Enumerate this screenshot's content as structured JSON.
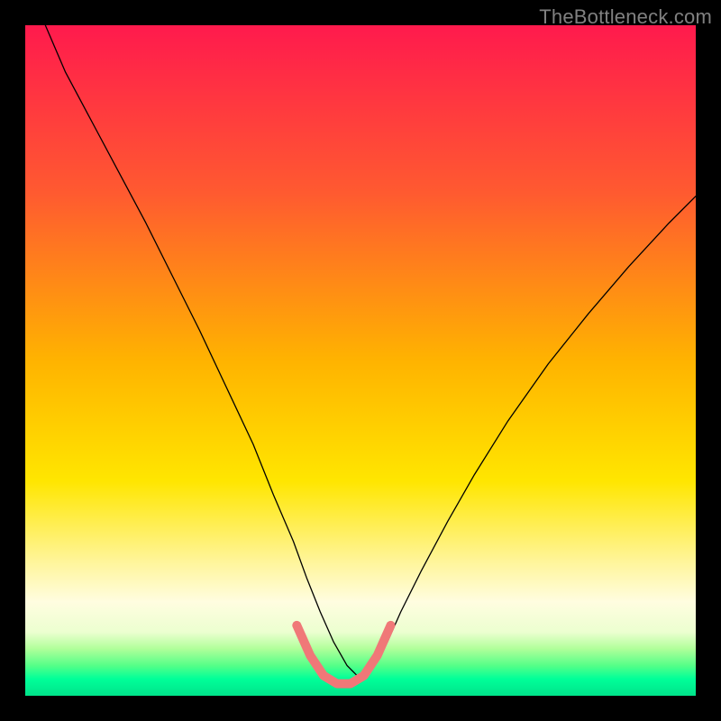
{
  "watermark": "TheBottleneck.com",
  "chart_data": {
    "type": "line",
    "title": "",
    "xlabel": "",
    "ylabel": "",
    "xlim": [
      0,
      100
    ],
    "ylim": [
      0,
      100
    ],
    "grid": false,
    "background": {
      "type": "linear-gradient",
      "direction": "top-to-bottom",
      "stops": [
        {
          "pos": 0.0,
          "color": "#ff1a4d"
        },
        {
          "pos": 0.25,
          "color": "#ff5a30"
        },
        {
          "pos": 0.5,
          "color": "#ffb300"
        },
        {
          "pos": 0.68,
          "color": "#ffe600"
        },
        {
          "pos": 0.8,
          "color": "#fff59a"
        },
        {
          "pos": 0.86,
          "color": "#fffde0"
        },
        {
          "pos": 0.905,
          "color": "#ecffd0"
        },
        {
          "pos": 0.93,
          "color": "#b0ff9a"
        },
        {
          "pos": 0.955,
          "color": "#55ff88"
        },
        {
          "pos": 0.975,
          "color": "#00ff99"
        },
        {
          "pos": 1.0,
          "color": "#00e38a"
        }
      ]
    },
    "series": [
      {
        "name": "bottleneck-curve",
        "stroke": "#000000",
        "stroke_width": 1.3,
        "x": [
          3,
          6,
          10,
          14,
          18,
          22,
          26,
          30,
          34,
          37,
          40,
          42,
          44,
          46,
          48,
          50,
          52,
          54,
          56,
          59,
          63,
          67,
          72,
          78,
          84,
          90,
          96,
          100
        ],
        "y": [
          100,
          93,
          85.5,
          78,
          70.5,
          62.5,
          54.5,
          46,
          37.5,
          30,
          23,
          17.5,
          12.5,
          8,
          4.5,
          2.5,
          4.5,
          8,
          12.5,
          18.5,
          26,
          33,
          41,
          49.5,
          57,
          64,
          70.5,
          74.5
        ]
      }
    ],
    "annotations": [
      {
        "name": "valley-highlight",
        "type": "path",
        "stroke": "#f07878",
        "stroke_width": 10,
        "x": [
          40.5,
          42.5,
          44.5,
          46.5,
          48.5,
          50.5,
          52.5,
          54.5
        ],
        "y": [
          10.5,
          6.0,
          3.0,
          1.8,
          1.8,
          3.0,
          6.0,
          10.5
        ]
      }
    ]
  }
}
